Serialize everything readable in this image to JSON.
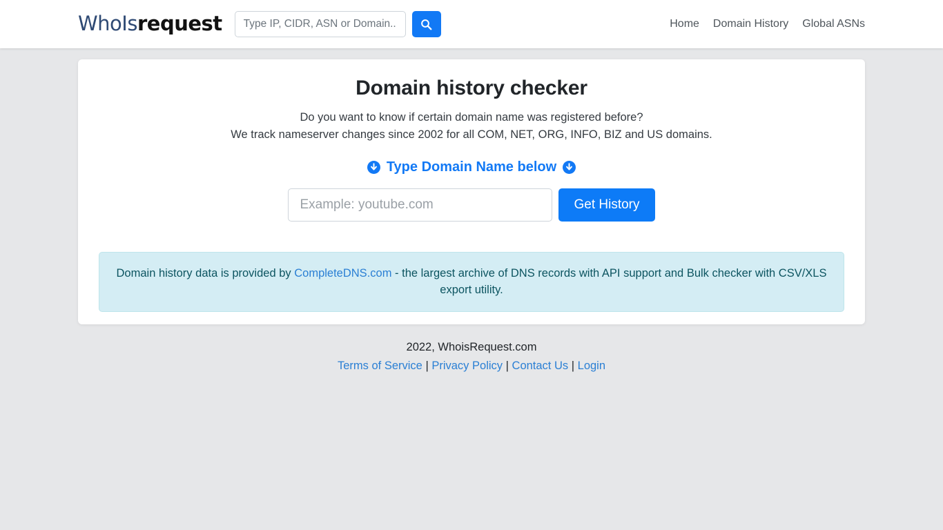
{
  "header": {
    "brand": {
      "part1": "WhoIs",
      "part2": "request"
    },
    "search": {
      "placeholder": "Type IP, CIDR, ASN or Domain..",
      "value": "",
      "button_icon": "search-icon"
    },
    "nav": [
      {
        "label": "Home"
      },
      {
        "label": "Domain History"
      },
      {
        "label": "Global ASNs"
      }
    ]
  },
  "main": {
    "title": "Domain history checker",
    "lead_line1": "Do you want to know if certain domain name was registered before?",
    "lead_line2": "We track nameserver changes since 2002 for all COM, NET, ORG, INFO, BIZ and US domains.",
    "prompt": "Type Domain Name below",
    "prompt_icon_left": "arrow-down-circle-icon",
    "prompt_icon_right": "arrow-down-circle-icon",
    "domain_input": {
      "placeholder": "Example: youtube.com",
      "value": ""
    },
    "submit_label": "Get History",
    "alert": {
      "text_before": "Domain history data is provided by ",
      "link_label": "CompleteDNS.com",
      "text_after": " - the largest archive of DNS records with API support and Bulk checker with CSV/XLS export utility."
    }
  },
  "footer": {
    "copyright": "2022, WhoisRequest.com",
    "links": [
      {
        "label": "Terms of Service"
      },
      {
        "label": "Privacy Policy"
      },
      {
        "label": "Contact Us"
      },
      {
        "label": "Login"
      }
    ],
    "separator": "|"
  },
  "colors": {
    "accent_blue": "#1279f5",
    "button_blue": "#0d7bf7",
    "brand_navy": "#2f4a74",
    "page_bg": "#e6e7e9",
    "alert_bg": "#d4edf4",
    "alert_text": "#0c5460",
    "link_blue": "#2a7fd4"
  }
}
